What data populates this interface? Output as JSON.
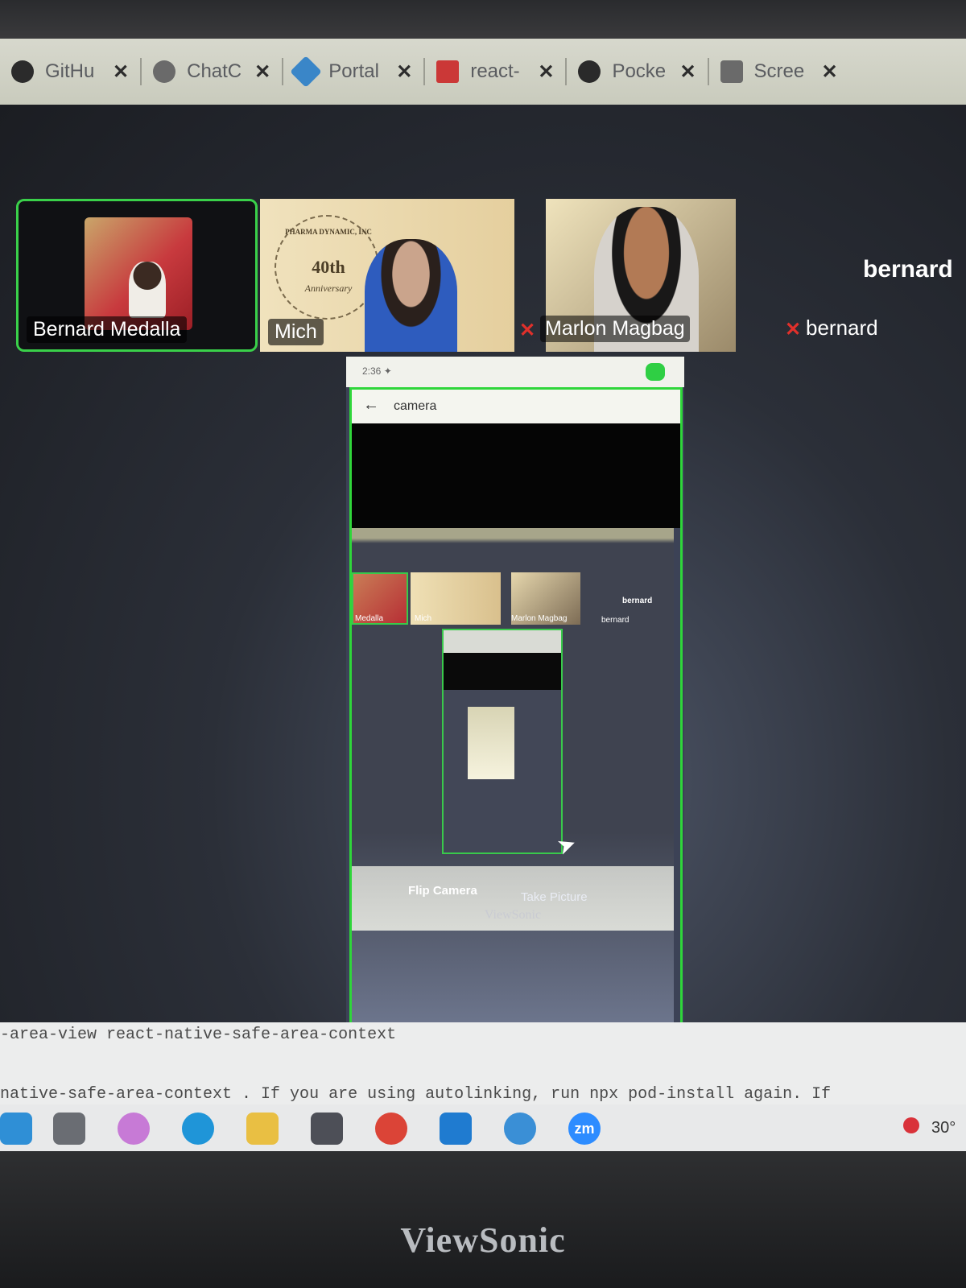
{
  "browser": {
    "tabs": [
      {
        "title": "GitHu",
        "icon": "github-icon",
        "color": "#2b2b2b"
      },
      {
        "title": "ChatC",
        "icon": "openai-icon",
        "color": "#6a6a6a"
      },
      {
        "title": "Portal",
        "icon": "portal-icon",
        "color": "#3a86c8"
      },
      {
        "title": "react-",
        "icon": "npm-icon",
        "color": "#cb3837"
      },
      {
        "title": "Pocke",
        "icon": "globe-icon",
        "color": "#2a2a2a"
      },
      {
        "title": "Scree",
        "icon": "screen-icon",
        "color": "#6a6a6a"
      }
    ],
    "close_glyph": "✕"
  },
  "meeting": {
    "participants": [
      {
        "name": "Bernard Medalla",
        "active_speaker": true
      },
      {
        "name": "Mich"
      },
      {
        "name": "Marlon Magbag",
        "muted": true
      },
      {
        "name": "bernard",
        "muted": true,
        "camera_off": true
      }
    ],
    "big_name": "bernard",
    "background_seal": {
      "arc": "PHARMA DYNAMIC, INC",
      "big": "40th",
      "sub": "Anniversary"
    },
    "accent_color": "#3ad04a",
    "muted_color": "#e0302b"
  },
  "shared_screen": {
    "status_time": "2:36 ✦",
    "appbar_title": "camera",
    "back_glyph": "←",
    "mini_labels": [
      "Medalla",
      "Mich",
      "Marlon Magbag",
      "bernard",
      "bernard"
    ],
    "flip_camera": "Flip Camera",
    "take_picture": "Take Picture",
    "brand": "ViewSonic"
  },
  "terminal": {
    "line1": "-area-view react-native-safe-area-context",
    "line2": "native-safe-area-context . If you are using autolinking, run  npx pod-install  again. If"
  },
  "taskbar": {
    "apps": [
      {
        "icon": "file-explorer-icon",
        "color": "#2f8fd6"
      },
      {
        "icon": "task-view-icon",
        "color": "#6a6d73"
      },
      {
        "icon": "copilot-icon",
        "color": "#c77ad6"
      },
      {
        "icon": "edge-icon",
        "color": "#1f95d8"
      },
      {
        "icon": "folder-icon",
        "color": "#e9bf43"
      },
      {
        "icon": "sticky-notes-icon",
        "color": "#4d4f57"
      },
      {
        "icon": "chrome-icon",
        "color": "#db4437"
      },
      {
        "icon": "vscode-icon",
        "color": "#1f7bd0"
      },
      {
        "icon": "refresh-app-icon",
        "color": "#3a8fd6"
      },
      {
        "icon": "zoom-icon",
        "color": "#2d8cff",
        "label": "zm"
      }
    ],
    "temperature": "30°"
  },
  "monitor_brand": "ViewSonic"
}
